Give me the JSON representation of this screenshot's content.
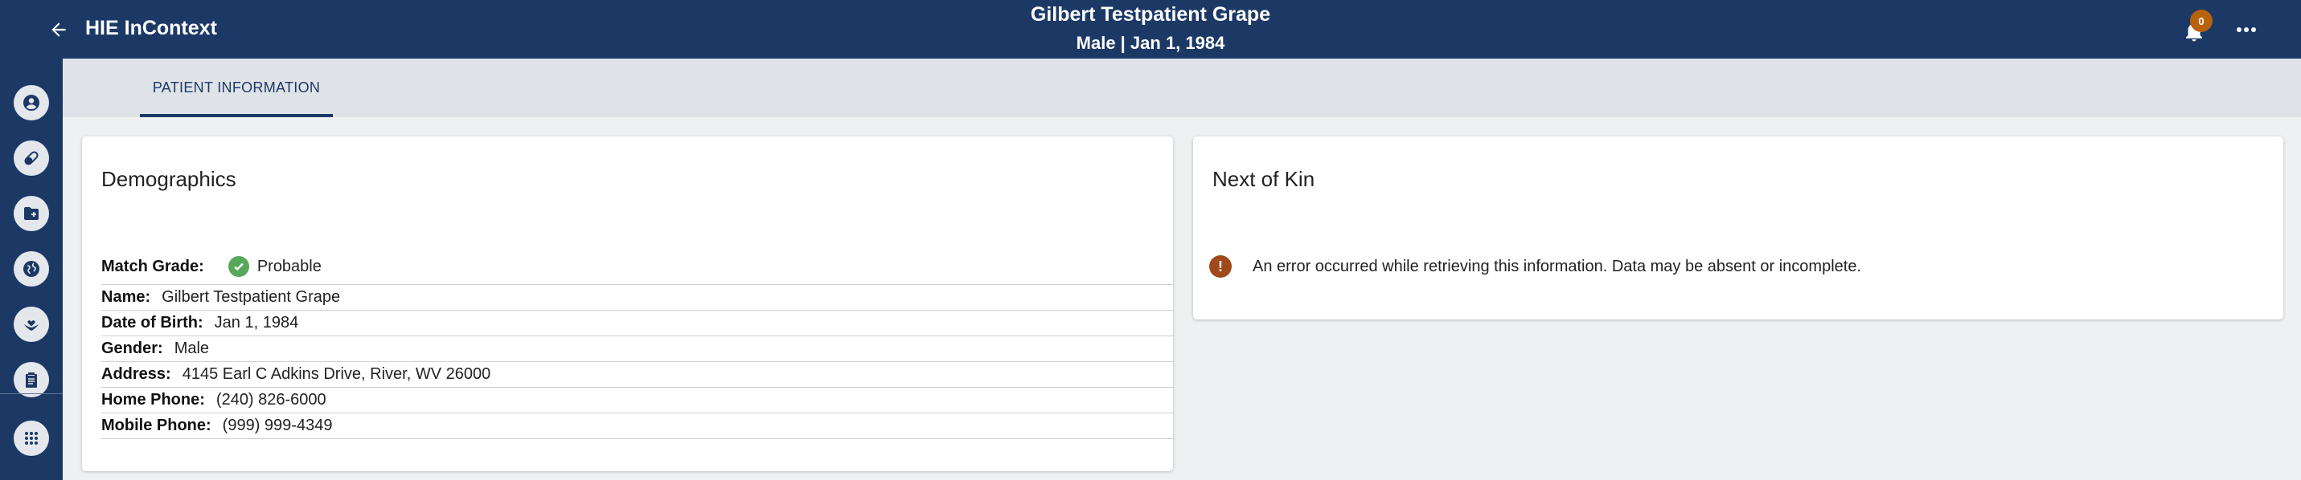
{
  "app": {
    "title": "HIE InContext"
  },
  "patient": {
    "name": "Gilbert Testpatient Grape",
    "summary": "Male | Jan 1, 1984"
  },
  "notifications": {
    "count": "0"
  },
  "tabs": [
    {
      "label": "PATIENT INFORMATION",
      "active": true
    }
  ],
  "sidebar": {
    "items": [
      {
        "icon": "account-circle-icon"
      },
      {
        "icon": "pill-icon"
      },
      {
        "icon": "folder-plus-icon"
      },
      {
        "icon": "globe-icon"
      },
      {
        "icon": "hand-heart-icon"
      },
      {
        "icon": "clipboard-icon"
      },
      {
        "icon": "apps-grid-icon"
      }
    ]
  },
  "demographics": {
    "title": "Demographics",
    "match_grade": {
      "label": "Match Grade:",
      "value": "Probable"
    },
    "rows": [
      {
        "label": "Name:",
        "value": "Gilbert Testpatient Grape"
      },
      {
        "label": "Date of Birth:",
        "value": "Jan 1, 1984"
      },
      {
        "label": "Gender:",
        "value": "Male"
      },
      {
        "label": "Address:",
        "value": "4145 Earl C Adkins Drive, River, WV 26000"
      },
      {
        "label": "Home Phone:",
        "value": "(240) 826-6000"
      },
      {
        "label": "Mobile Phone:",
        "value": "(999) 999-4349"
      }
    ]
  },
  "next_of_kin": {
    "title": "Next of Kin",
    "error_message": "An error occurred while retrieving this information. Data may be absent or incomplete."
  },
  "colors": {
    "brand": "#1c3966",
    "badge": "#b8620c",
    "success": "#58a85a",
    "error": "#a04a1c"
  }
}
